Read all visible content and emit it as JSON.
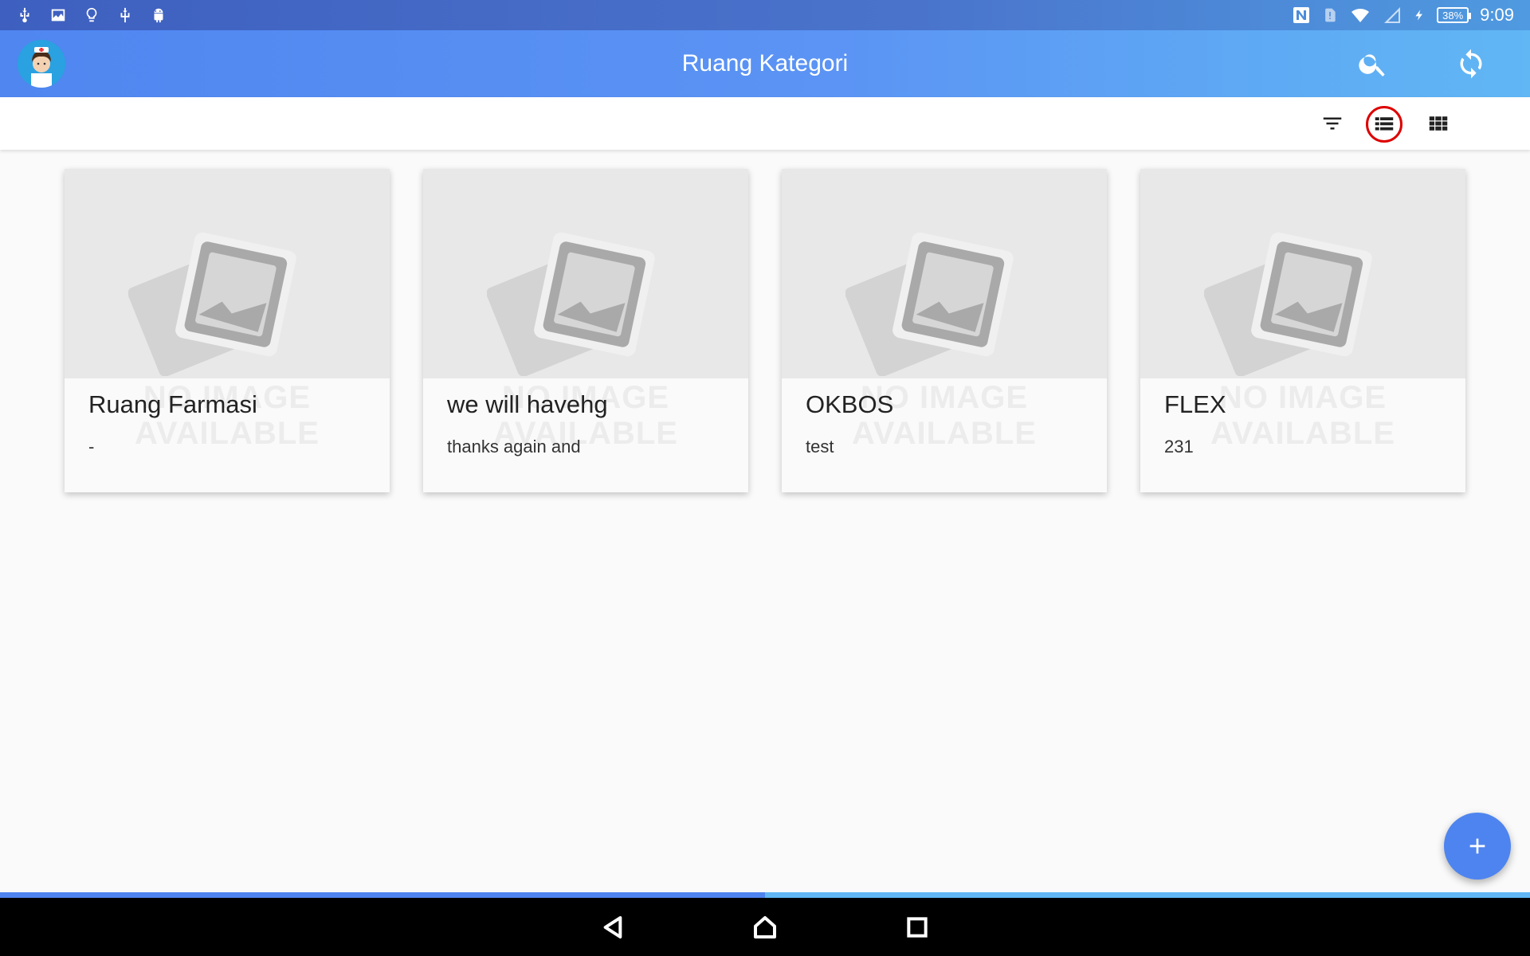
{
  "status_bar": {
    "time": "9:09",
    "battery": "38%",
    "left_icons": [
      "usb-icon",
      "image-icon",
      "bulb-icon",
      "usb-debug-icon",
      "android-icon"
    ],
    "right_icons": [
      "nfc-icon",
      "sim-alert-icon",
      "wifi-icon",
      "signal-icon",
      "charging-icon",
      "battery-icon"
    ]
  },
  "app_bar": {
    "title": "Ruang Kategori",
    "icons": [
      "avatar",
      "search-icon",
      "sync-icon"
    ]
  },
  "toolbar": {
    "icons": [
      "filter-icon",
      "list-view-icon",
      "grid-view-icon"
    ],
    "selected": "list-view-icon"
  },
  "cards": [
    {
      "title": "Ruang Farmasi",
      "subtitle": "-",
      "watermark_line1": "NO IMAGE",
      "watermark_line2": "AVAILABLE"
    },
    {
      "title": "we will havehg",
      "subtitle": "thanks again and",
      "watermark_line1": "NO IMAGE",
      "watermark_line2": "AVAILABLE"
    },
    {
      "title": "OKBOS",
      "subtitle": "test",
      "watermark_line1": "NO IMAGE",
      "watermark_line2": "AVAILABLE"
    },
    {
      "title": "FLEX",
      "subtitle": "231",
      "watermark_line1": "NO IMAGE",
      "watermark_line2": "AVAILABLE"
    }
  ],
  "fab": {
    "icon": "plus-icon"
  },
  "progress": {
    "value": 0.5
  },
  "nav_bar": {
    "buttons": [
      "back-icon",
      "home-icon",
      "recents-icon"
    ]
  },
  "colors": {
    "accent": "#4e84ef",
    "appbar_start": "#4f86f0",
    "appbar_end": "#60b7f4",
    "highlight": "#dd0000"
  }
}
